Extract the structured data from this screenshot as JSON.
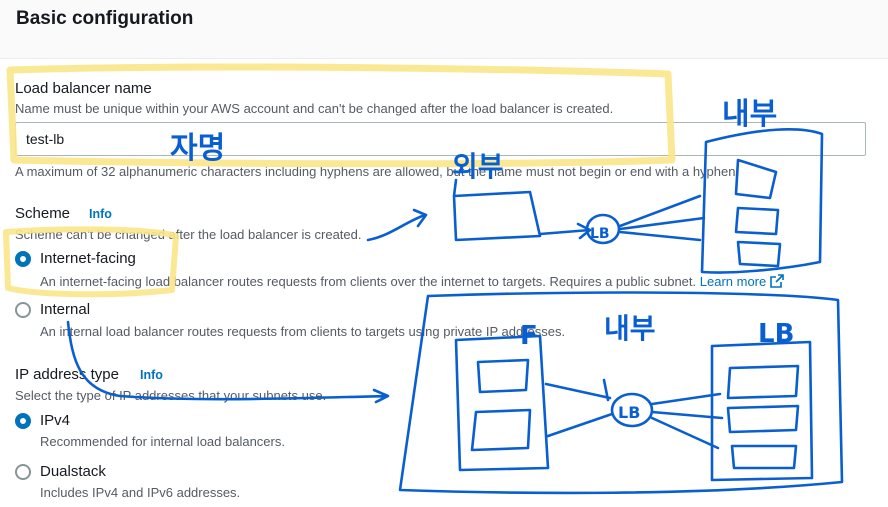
{
  "section": {
    "title": "Basic configuration"
  },
  "load_balancer_name": {
    "label": "Load balancer name",
    "description": "Name must be unique within your AWS account and can't be changed after the load balancer is created.",
    "value": "test-lb",
    "constraint": "A maximum of 32 alphanumeric characters including hyphens are allowed, but the name must not begin or end with a hyphen."
  },
  "scheme": {
    "label": "Scheme",
    "info": "Info",
    "description": "Scheme can't be changed after the load balancer is created.",
    "options": [
      {
        "label": "Internet-facing",
        "description": "An internet-facing load balancer routes requests from clients over the internet to targets. Requires a public subnet.",
        "link": "Learn more",
        "selected": true
      },
      {
        "label": "Internal",
        "description": "An internal load balancer routes requests from clients to targets using private IP addresses.",
        "selected": false
      }
    ]
  },
  "ip_address_type": {
    "label": "IP address type",
    "info": "Info",
    "description": "Select the type of IP addresses that your subnets use.",
    "options": [
      {
        "label": "IPv4",
        "description": "Recommended for internal load balancers.",
        "selected": true
      },
      {
        "label": "Dualstack",
        "description": "Includes IPv4 and IPv6 addresses.",
        "selected": false
      }
    ]
  },
  "annotations": {
    "name_note": "자명",
    "external_label": "외부",
    "internal_label_top": "내부",
    "internal_label_bottom": "내부",
    "lb_label": "LB",
    "lb_label_lower": "LB",
    "f_mark": "F",
    "lb_mark": "LB",
    "highlight_color": "#fbe68a",
    "pen_color": "#0a5fd0"
  },
  "colors": {
    "primary": "#0073bb",
    "text": "#16191f",
    "muted": "#545b64",
    "border": "#aab7b8"
  }
}
